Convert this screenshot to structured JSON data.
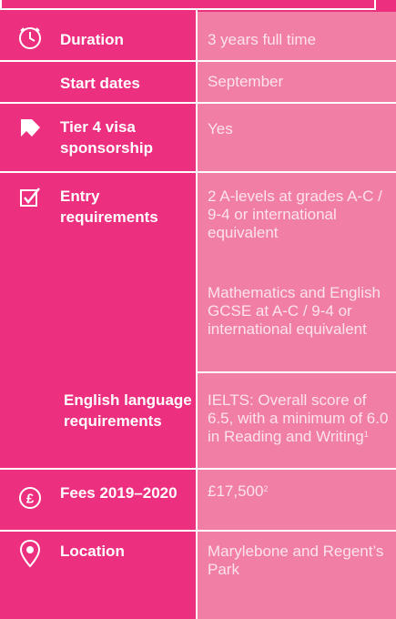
{
  "colors": {
    "panel_left": "#ec2f7f",
    "panel_right": "#f17ea4",
    "label": "#ffffff",
    "value": "#fde3ec"
  },
  "rows": {
    "duration": {
      "icon": "clock-icon",
      "label": "Duration",
      "value": "3 years full time"
    },
    "start": {
      "label": "Start dates",
      "value": "September"
    },
    "visa": {
      "icon": "tag-icon",
      "label": "Tier 4 visa sponsorship",
      "value": "Yes"
    },
    "entry": {
      "icon": "checkbox-icon",
      "label": "Entry requirements",
      "value1": "2 A-levels at grades A-C / 9-4 or international equivalent",
      "value2": "Mathematics and English GCSE at A-C / 9-4 or international equivalent"
    },
    "english": {
      "label": "English language requirements",
      "value": "IELTS: Overall score of 6.5, with a minimum of 6.0 in Reading and Writing",
      "note": "1"
    },
    "fees": {
      "icon": "pound-icon",
      "label": "Fees 2019–2020",
      "value": "£17,500",
      "note": "2"
    },
    "location": {
      "icon": "location-pin-icon",
      "label": "Location",
      "value": "Marylebone and Regent’s Park"
    }
  }
}
